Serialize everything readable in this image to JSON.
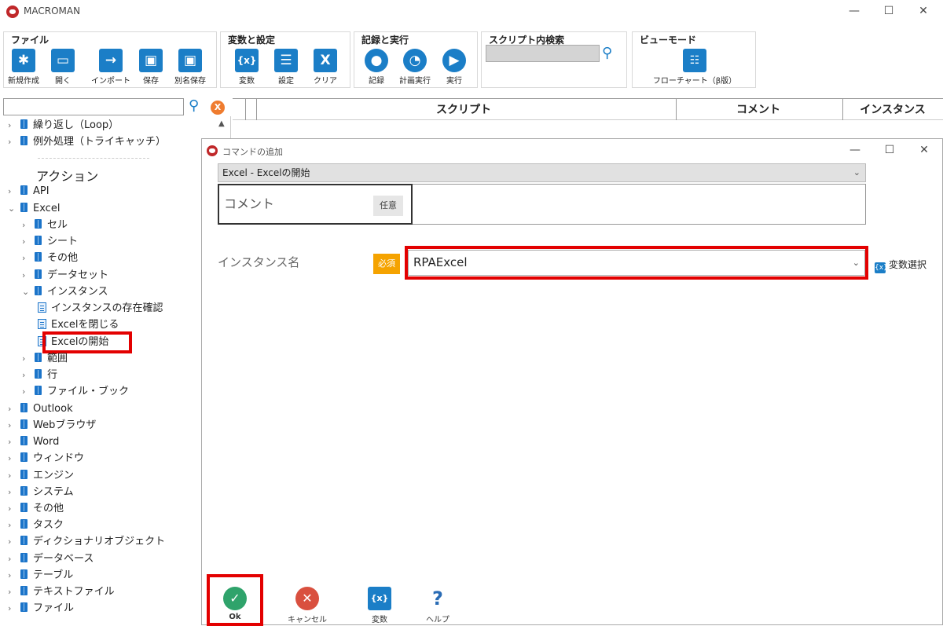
{
  "app": {
    "title": "MACROMAN",
    "minimize": "—",
    "maximize": "☐",
    "close": "✕"
  },
  "ribbon": {
    "file": {
      "label": "ファイル",
      "buttons": [
        "新規作成",
        "開く",
        "インポート",
        "保存",
        "別名保存"
      ]
    },
    "vars": {
      "label": "変数と設定",
      "buttons": [
        "変数",
        "設定",
        "クリア"
      ]
    },
    "record": {
      "label": "記録と実行",
      "buttons": [
        "記録",
        "計画実行",
        "実行"
      ]
    },
    "search": {
      "label": "スクリプト内検索",
      "value": ""
    },
    "view": {
      "label": "ビューモード",
      "buttons": [
        "フローチャート（β版）"
      ]
    }
  },
  "left_panel": {
    "search_value": "",
    "tree": [
      {
        "indent": 0,
        "chev": ">",
        "icon": "book",
        "label": "繰り返し（Loop）"
      },
      {
        "indent": 0,
        "chev": ">",
        "icon": "book",
        "label": "例外処理（トライキャッチ）"
      },
      {
        "indent": 0,
        "chev": "",
        "icon": "none",
        "label": "アクション",
        "heading": true
      },
      {
        "indent": 0,
        "chev": ">",
        "icon": "book",
        "label": "API"
      },
      {
        "indent": 0,
        "chev": "v",
        "icon": "book",
        "label": "Excel"
      },
      {
        "indent": 1,
        "chev": ">",
        "icon": "book",
        "label": "セル"
      },
      {
        "indent": 1,
        "chev": ">",
        "icon": "book",
        "label": "シート"
      },
      {
        "indent": 1,
        "chev": ">",
        "icon": "book",
        "label": "その他"
      },
      {
        "indent": 1,
        "chev": ">",
        "icon": "book",
        "label": "データセット"
      },
      {
        "indent": 1,
        "chev": "v",
        "icon": "book",
        "label": "インスタンス"
      },
      {
        "indent": 2,
        "chev": "",
        "icon": "doc",
        "label": "インスタンスの存在確認"
      },
      {
        "indent": 2,
        "chev": "",
        "icon": "doc",
        "label": "Excelを閉じる"
      },
      {
        "indent": 2,
        "chev": "",
        "icon": "doc",
        "label": "Excelの開始",
        "highlight": true
      },
      {
        "indent": 1,
        "chev": ">",
        "icon": "book",
        "label": "範囲"
      },
      {
        "indent": 1,
        "chev": ">",
        "icon": "book",
        "label": "行"
      },
      {
        "indent": 1,
        "chev": ">",
        "icon": "book",
        "label": "ファイル・ブック"
      },
      {
        "indent": 0,
        "chev": ">",
        "icon": "book",
        "label": "Outlook"
      },
      {
        "indent": 0,
        "chev": ">",
        "icon": "book",
        "label": "Webブラウザ"
      },
      {
        "indent": 0,
        "chev": ">",
        "icon": "book",
        "label": "Word"
      },
      {
        "indent": 0,
        "chev": ">",
        "icon": "book",
        "label": "ウィンドウ"
      },
      {
        "indent": 0,
        "chev": ">",
        "icon": "book",
        "label": "エンジン"
      },
      {
        "indent": 0,
        "chev": ">",
        "icon": "book",
        "label": "システム"
      },
      {
        "indent": 0,
        "chev": ">",
        "icon": "book",
        "label": "その他"
      },
      {
        "indent": 0,
        "chev": ">",
        "icon": "book",
        "label": "タスク"
      },
      {
        "indent": 0,
        "chev": ">",
        "icon": "book",
        "label": "ディクショナリオブジェクト"
      },
      {
        "indent": 0,
        "chev": ">",
        "icon": "book",
        "label": "データベース"
      },
      {
        "indent": 0,
        "chev": ">",
        "icon": "book",
        "label": "テーブル"
      },
      {
        "indent": 0,
        "chev": ">",
        "icon": "book",
        "label": "テキストファイル"
      },
      {
        "indent": 0,
        "chev": ">",
        "icon": "book",
        "label": "ファイル"
      }
    ]
  },
  "script_table": {
    "columns": [
      "スクリプト",
      "コメント",
      "インスタンス"
    ]
  },
  "dialog": {
    "title": "コマンドの追加",
    "command": "Excel - Excelの開始",
    "comment_label": "コメント",
    "optional": "任意",
    "comment_value": "",
    "instance_label": "インスタンス名",
    "required": "必須",
    "instance_value": "RPAExcel",
    "var_select": "変数選択",
    "buttons": {
      "ok": "Ok",
      "cancel": "キャンセル",
      "variables": "変数",
      "help": "ヘルプ"
    }
  },
  "colors": {
    "accent": "#1b7ec7",
    "highlight": "#e30000",
    "required": "#f5a300",
    "ok": "#2fa36b",
    "cancel": "#d9503f"
  }
}
